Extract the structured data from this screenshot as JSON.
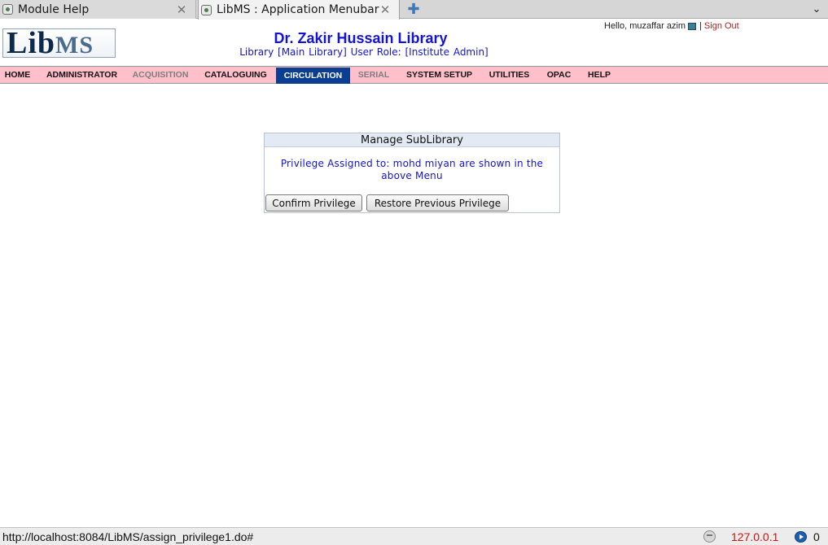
{
  "browser": {
    "tabs": [
      {
        "title": "Module Help",
        "close_icon": "close-icon",
        "active": false
      },
      {
        "title": "LibMS : Application Menubar",
        "close_icon": "close-icon",
        "active": true
      }
    ],
    "new_tab_icon": "plus-icon",
    "tab_list_icon": "chevron-down-icon"
  },
  "header": {
    "logo": {
      "part1": "Lib",
      "part2": "MS"
    },
    "title": "Dr. Zakir Hussain Library",
    "subtitle": "Library [Main Library]  User Role: [Institute Admin]",
    "greeting": "Hello,",
    "username": "muzaffar azim",
    "separator": "|",
    "sign_out": "Sign Out"
  },
  "menu": {
    "items": [
      {
        "label": "HOME",
        "state": "normal"
      },
      {
        "label": "ADMINISTRATOR",
        "state": "normal"
      },
      {
        "label": "ACQUISITION",
        "state": "disabled"
      },
      {
        "label": "CATALOGUING",
        "state": "normal"
      },
      {
        "label": "CIRCULATION",
        "state": "active"
      },
      {
        "label": "SERIAL",
        "state": "disabled"
      },
      {
        "label": "SYSTEM SETUP",
        "state": "normal"
      },
      {
        "label": "UTILITIES",
        "state": "normal"
      },
      {
        "label": "OPAC",
        "state": "normal"
      },
      {
        "label": "HELP",
        "state": "normal"
      }
    ],
    "colors": {
      "bar": "#ffc0cb",
      "active_bg": "#0b3d91",
      "active_text": "#ffffff",
      "disabled_text": "#7d7d7d"
    }
  },
  "dialog": {
    "title": "Manage SubLibrary",
    "message": "Privilege Assigned to: mohd miyan are shown in the above Menu",
    "confirm_button": "Confirm Privilege",
    "restore_button": "Restore Previous Privilege"
  },
  "status": {
    "url": "http://localhost:8084/LibMS/assign_privilege1.do#",
    "ip": "127.0.0.1",
    "message_count": "0"
  }
}
